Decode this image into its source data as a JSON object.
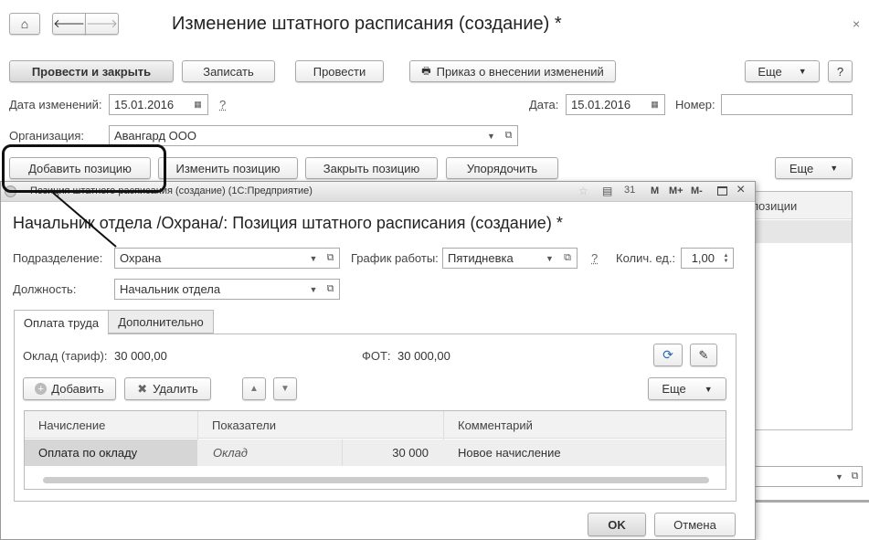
{
  "main": {
    "title": "Изменение штатного расписания (создание) *",
    "toolbar": {
      "post_close": "Провести и закрыть",
      "save": "Записать",
      "post": "Провести",
      "order": "Приказ о внесении изменений",
      "more": "Еще",
      "help": "?"
    },
    "fields": {
      "change_date_label": "Дата изменений:",
      "change_date": "15.01.2016",
      "date_label": "Дата:",
      "date": "15.01.2016",
      "number_label": "Номер:",
      "number": "",
      "org_label": "Организация:",
      "org": "Авангард ООО",
      "hint": "?"
    },
    "positions_toolbar": {
      "add": "Добавить позицию",
      "edit": "Изменить позицию",
      "close": "Закрыть позицию",
      "sort": "Упорядочить",
      "more": "Еще"
    },
    "table_header_fragment": "позиции"
  },
  "dialog": {
    "window_title": "Позиция штатного расписания (создание)  (1С:Предприятие)",
    "title_buttons": [
      "M",
      "M+",
      "M-"
    ],
    "heading": "Начальник отдела /Охрана/: Позиция штатного расписания (создание) *",
    "dept_label": "Подразделение:",
    "dept": "Охрана",
    "schedule_label": "График работы:",
    "schedule": "Пятидневка",
    "hint": "?",
    "qty_label": "Колич. ед.:",
    "qty": "1,00",
    "position_label": "Должность:",
    "position": "Начальник отдела",
    "tabs": [
      {
        "label": "Оплата труда",
        "active": true
      },
      {
        "label": "Дополнительно",
        "active": false
      }
    ],
    "salary_label": "Оклад (тариф):",
    "salary": "30 000,00",
    "fot_label": "ФОТ:",
    "fot": "30 000,00",
    "toolbar": {
      "add": "Добавить",
      "delete": "Удалить",
      "more": "Еще"
    },
    "table": {
      "columns": [
        "Начисление",
        "Показатели",
        "Комментарий"
      ],
      "rows": [
        {
          "accrual": "Оплата по окладу",
          "indicator": "Оклад",
          "value": "30 000",
          "comment": "Новое начисление"
        }
      ]
    },
    "ok": "OK",
    "cancel": "Отмена"
  }
}
